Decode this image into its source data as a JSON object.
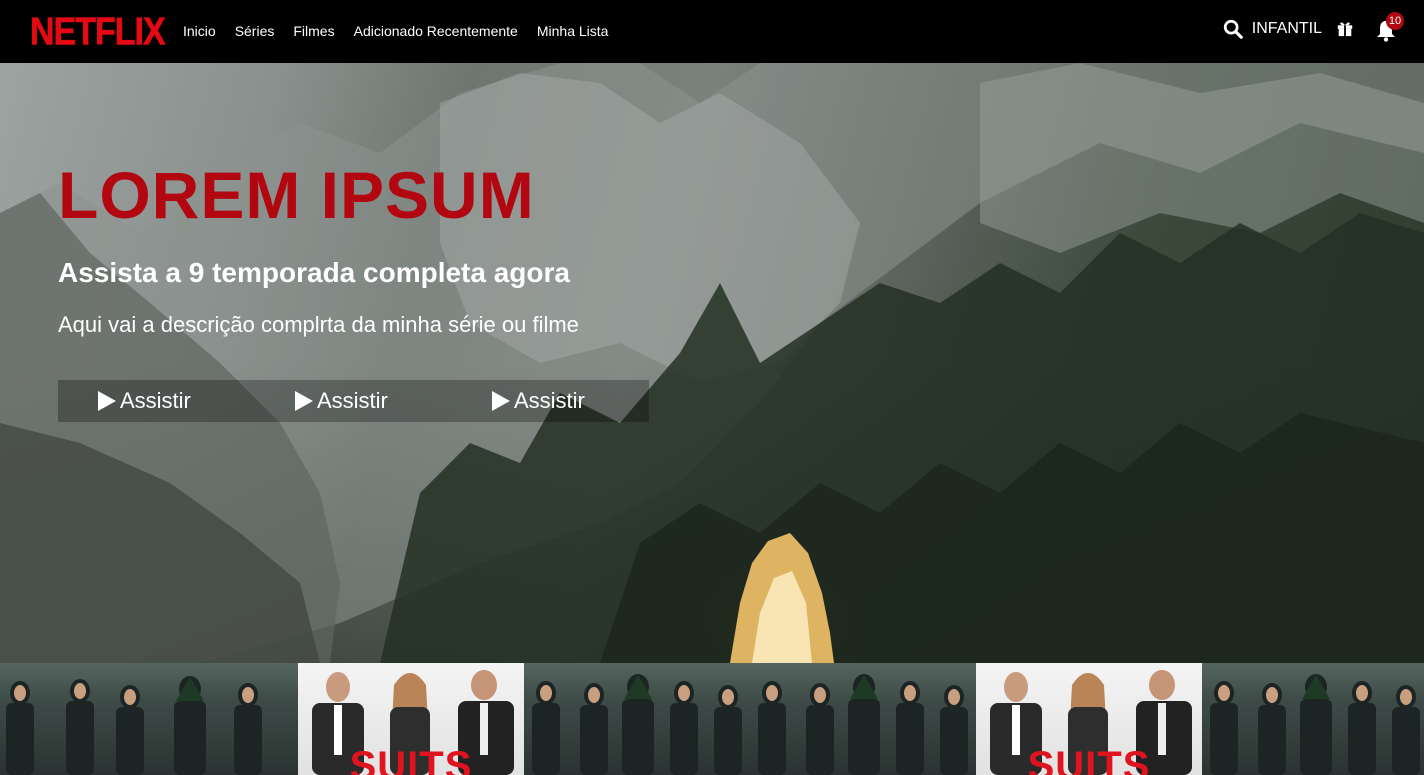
{
  "header": {
    "logo": "NETFLIX",
    "nav": [
      "Inicio",
      "Séries",
      "Filmes",
      "Adicionado Recentemente",
      "Minha Lista"
    ],
    "kids_label": "INFANTIL",
    "notification_count": "10",
    "icons": [
      "search-icon",
      "gift-icon",
      "bell-icon"
    ]
  },
  "hero": {
    "title": "LOREM IPSUM",
    "subtitle": "Assista a 9 temporada completa agora",
    "description": "Aqui vai a descrição complrta da minha série ou filme",
    "buttons": [
      "Assistir",
      "Assistir",
      "Assistir"
    ]
  },
  "row": {
    "thumbnails": [
      {
        "type": "arrow"
      },
      {
        "type": "suits",
        "label": "SUITS"
      },
      {
        "type": "arrow"
      },
      {
        "type": "arrow"
      },
      {
        "type": "suits",
        "label": "SUITS"
      },
      {
        "type": "arrow"
      }
    ]
  },
  "colors": {
    "brand_red": "#e50914",
    "title_red": "#b20710",
    "badge_red": "#b00710"
  }
}
